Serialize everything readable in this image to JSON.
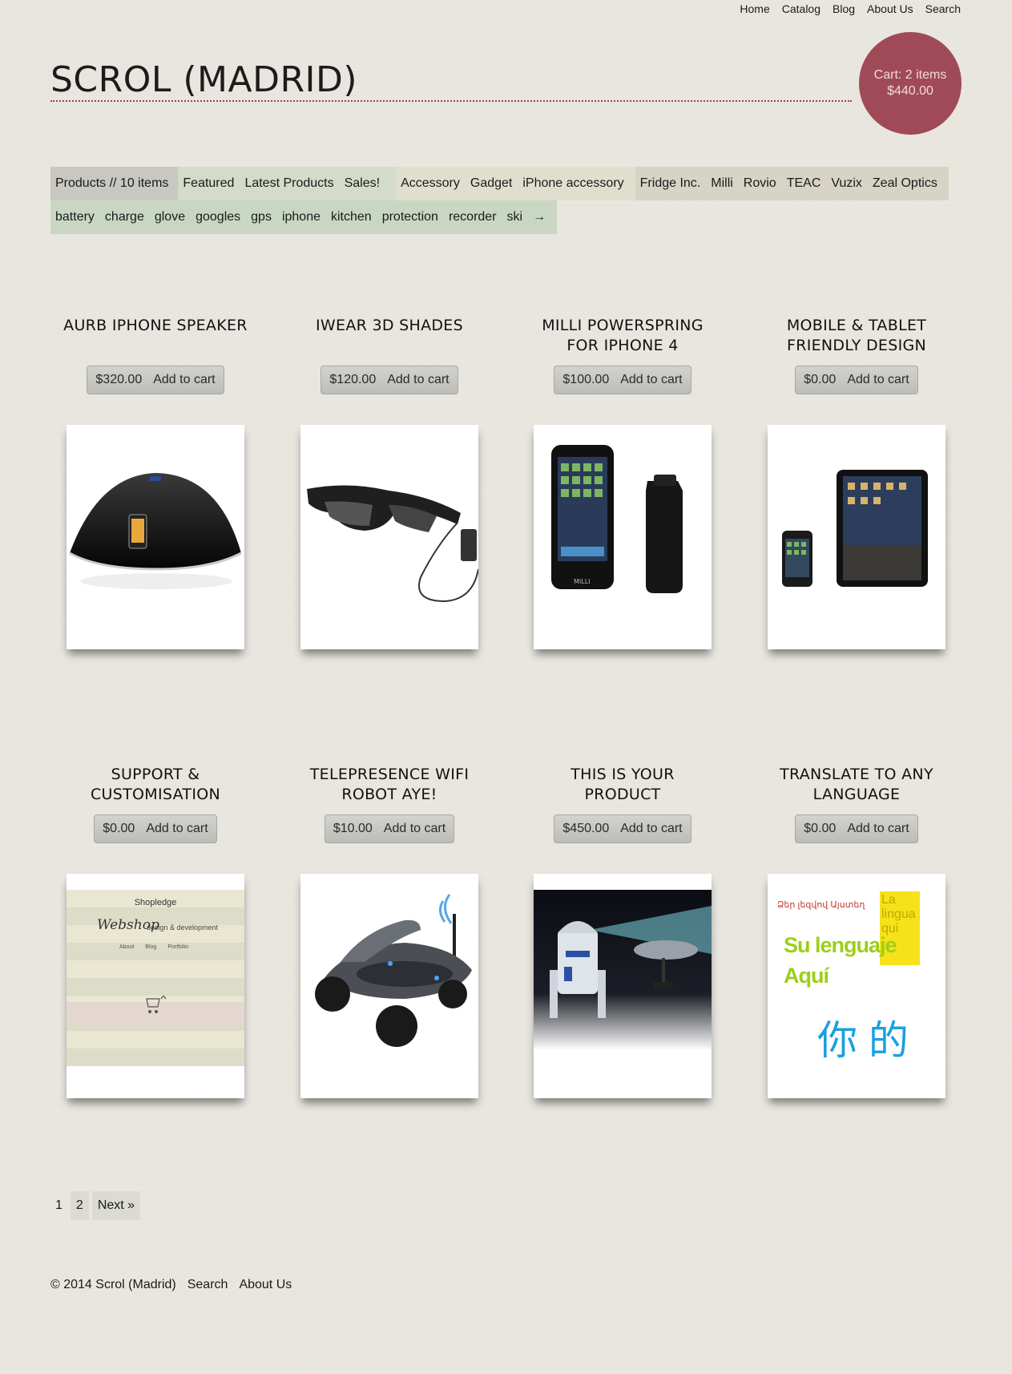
{
  "topnav": [
    "Home",
    "Catalog",
    "Blog",
    "About Us",
    "Search"
  ],
  "site_title": "SCROL (MADRID)",
  "cart": {
    "items": "Cart: 2 items",
    "total": "$440.00"
  },
  "filters": {
    "products_label": "Products // 10 items",
    "collections": [
      "Featured",
      "Latest Products",
      "Sales!"
    ],
    "types": [
      "Accessory",
      "Gadget",
      "iPhone accessory"
    ],
    "vendors": [
      "Fridge Inc.",
      "Milli",
      "Rovio",
      "TEAC",
      "Vuzix",
      "Zeal Optics"
    ],
    "tags": [
      "battery",
      "charge",
      "glove",
      "googles",
      "gps",
      "iphone",
      "kitchen",
      "protection",
      "recorder",
      "ski",
      "→"
    ]
  },
  "products": [
    {
      "title": "AURB IPHONE SPEAKER",
      "price": "$320.00",
      "cta": "Add to cart"
    },
    {
      "title": "IWEAR 3D SHADES",
      "price": "$120.00",
      "cta": "Add to cart"
    },
    {
      "title": "MILLI POWERSPRING FOR IPHONE 4",
      "price": "$100.00",
      "cta": "Add to cart"
    },
    {
      "title": "MOBILE & TABLET FRIENDLY DESIGN",
      "price": "$0.00",
      "cta": "Add to cart"
    },
    {
      "title": "SUPPORT & CUSTOMISATION",
      "price": "$0.00",
      "cta": "Add to cart"
    },
    {
      "title": "TELEPRESENCE WIFI ROBOT AYE!",
      "price": "$10.00",
      "cta": "Add to cart"
    },
    {
      "title": "THIS IS YOUR PRODUCT",
      "price": "$450.00",
      "cta": "Add to cart"
    },
    {
      "title": "TRANSLATE TO ANY LANGUAGE",
      "price": "$0.00",
      "cta": "Add to cart"
    }
  ],
  "thumbs": {
    "shopledge_title": "Shopledge",
    "shopledge_logo": "Webshop",
    "shopledge_tagline": "design & development",
    "shopledge_nav": [
      "About",
      "Blog",
      "Portfolio"
    ],
    "lang_armenian": "Ձեր լեզվով Այստեղ",
    "lang_spanish_1": "Su lenguaje",
    "lang_spanish_2": "Aquí",
    "lang_italian": "La lingua qui",
    "lang_chinese": "你 的"
  },
  "pagination": {
    "current": "1",
    "page2": "2",
    "next": "Next »"
  },
  "footer": {
    "copyright": "© 2014 Scrol (Madrid)",
    "links": [
      "Search",
      "About Us"
    ]
  },
  "colors": {
    "cart_bg": "#a04a58",
    "accent_rule": "#a0404d",
    "page_bg": "#e8e6df"
  }
}
